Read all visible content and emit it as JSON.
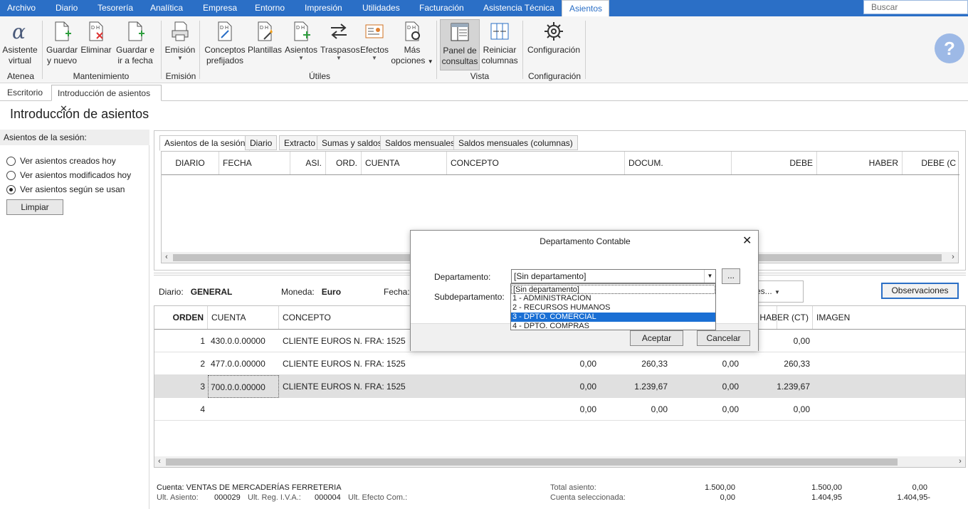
{
  "menu": [
    "Archivo",
    "Diario",
    "Tesorería",
    "Analítica",
    "Empresa",
    "Entorno",
    "Impresión",
    "Utilidades",
    "Facturación",
    "Asistencia Técnica",
    "Asientos"
  ],
  "search_placeholder": "Buscar",
  "ribbon": {
    "buttons": [
      {
        "l1": "Asistente",
        "l2": "virtual"
      },
      {
        "l1": "Guardar",
        "l2": "y nuevo"
      },
      {
        "l1": "Eliminar",
        "l2": ""
      },
      {
        "l1": "Guardar e",
        "l2": "ir a fecha"
      },
      {
        "l1": "Emisión",
        "l2": ""
      },
      {
        "l1": "Conceptos",
        "l2": "prefijados"
      },
      {
        "l1": "Plantillas",
        "l2": ""
      },
      {
        "l1": "Asientos",
        "l2": ""
      },
      {
        "l1": "Traspasos",
        "l2": ""
      },
      {
        "l1": "Efectos",
        "l2": ""
      },
      {
        "l1": "Más",
        "l2": "opciones"
      },
      {
        "l1": "Panel de",
        "l2": "consultas"
      },
      {
        "l1": "Reiniciar",
        "l2": "columnas"
      },
      {
        "l1": "Configuración",
        "l2": ""
      }
    ],
    "groups": [
      "Atenea",
      "Mantenimiento",
      "Emisión",
      "Útiles",
      "Vista",
      "Configuración"
    ]
  },
  "doc_tabs": [
    "Escritorio",
    "Introducción de asientos"
  ],
  "page_title": "Introducción de asientos",
  "left": {
    "header": "Asientos de la sesión:",
    "options": [
      "Ver asientos creados hoy",
      "Ver asientos modificados hoy",
      "Ver asientos según se usan"
    ],
    "selected_index": 2,
    "clear_button": "Limpiar"
  },
  "session_tabs": [
    "Asientos de la sesión",
    "Diario",
    "Extracto",
    "Sumas y saldos",
    "Saldos mensuales",
    "Saldos mensuales (columnas)"
  ],
  "grid1_columns": [
    "DIARIO",
    "FECHA",
    "ASI.",
    "ORD.",
    "CUENTA",
    "CONCEPTO",
    "DOCUM.",
    "DEBE",
    "HABER",
    "DEBE (C"
  ],
  "entry_info": {
    "diario_label": "Diario:",
    "diario_value": "GENERAL",
    "moneda_label": "Moneda:",
    "moneda_value": "Euro",
    "fecha_label": "Fecha:",
    "hidden_button_fragment": "es...",
    "observaciones_button": "Observaciones"
  },
  "grid2": {
    "columns": [
      "ORDEN",
      "CUENTA",
      "CONCEPTO",
      "HABER (CT)",
      "IMAGEN"
    ],
    "rows": [
      {
        "orden": "1",
        "cuenta": "430.0.0.00000",
        "concepto": "CLIENTE EUROS N. FRA:  1525",
        "c1": "",
        "c2": "",
        "c3": "",
        "c4": "0,00"
      },
      {
        "orden": "2",
        "cuenta": "477.0.0.00000",
        "concepto": "CLIENTE EUROS N. FRA:  1525",
        "c1": "0,00",
        "c2": "260,33",
        "c3": "0,00",
        "c4": "260,33"
      },
      {
        "orden": "3",
        "cuenta": "700.0.0.00000",
        "concepto": "CLIENTE EUROS N. FRA:  1525",
        "c1": "0,00",
        "c2": "1.239,67",
        "c3": "0,00",
        "c4": "1.239,67"
      },
      {
        "orden": "4",
        "cuenta": "",
        "concepto": "",
        "c1": "0,00",
        "c2": "0,00",
        "c3": "0,00",
        "c4": "0,00"
      }
    ],
    "selected_row": 2
  },
  "footer": {
    "cuenta": "Cuenta: VENTAS DE MERCADERÍAS FERRETERIA",
    "ult_asiento_label": "Ult. Asiento:",
    "ult_asiento": "000029",
    "ult_iva_label": "Ult. Reg. I.V.A.:",
    "ult_iva": "000004",
    "ult_efecto_label": "Ult. Efecto Com.:",
    "total_label": "Total asiento:",
    "total_values": [
      "1.500,00",
      "1.500,00",
      "0,00"
    ],
    "sel_label": "Cuenta seleccionada:",
    "sel_values": [
      "0,00",
      "1.404,95",
      "1.404,95-"
    ]
  },
  "dialog": {
    "title": "Departamento Contable",
    "dept_label": "Departamento:",
    "dept_value": "[Sin departamento]",
    "subdept_label": "Subdepartamento:",
    "dots_button": "...",
    "options": [
      "[Sin departamento]",
      "1 - ADMINISTRACION",
      "2 - RECURSOS HUMANOS",
      "3 - DPTO. COMERCIAL",
      "4 - DPTO. COMPRAS"
    ],
    "highlighted_option": 3,
    "accept": "Aceptar",
    "cancel": "Cancelar"
  },
  "colors": {
    "accent": "#2b6fc6",
    "highlight": "#1a6fd4",
    "selected_row": "#e0e0e0"
  }
}
